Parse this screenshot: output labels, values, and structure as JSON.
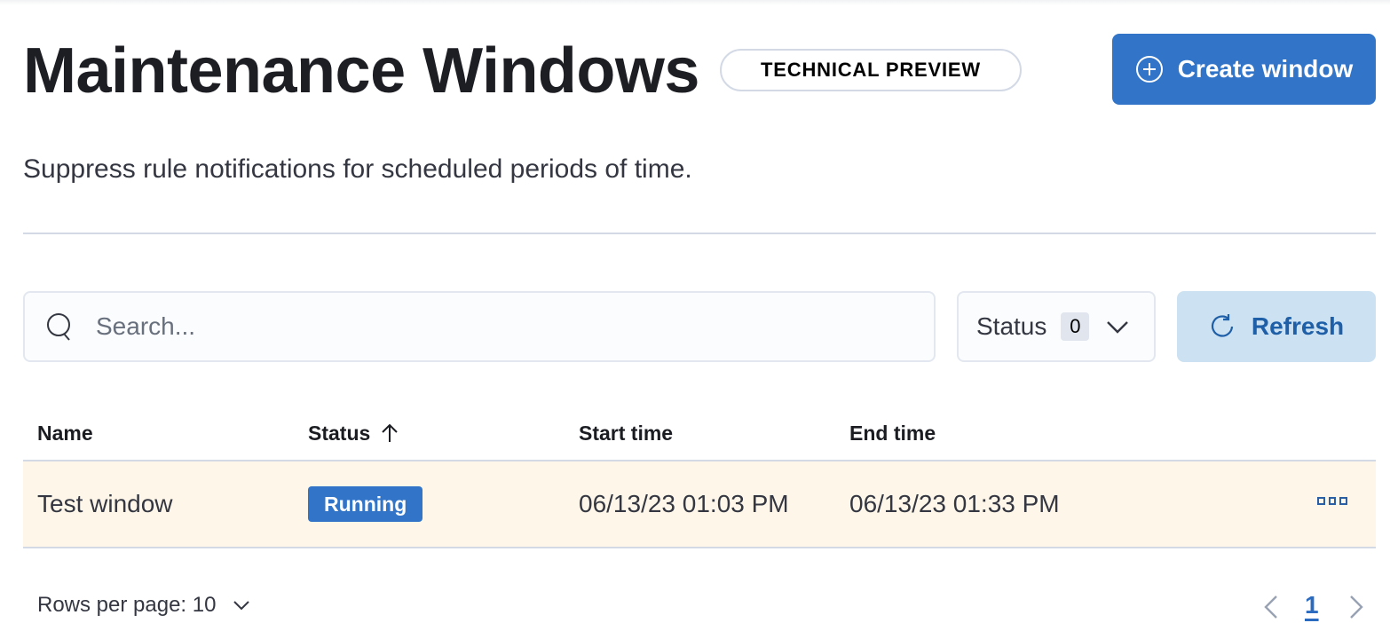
{
  "header": {
    "title": "Maintenance Windows",
    "badge": "TECHNICAL PREVIEW",
    "create_button": "Create window",
    "subtitle": "Suppress rule notifications for scheduled periods of time."
  },
  "toolbar": {
    "search_placeholder": "Search...",
    "search_value": "",
    "status_filter_label": "Status",
    "status_filter_count": "0",
    "refresh_label": "Refresh"
  },
  "table": {
    "columns": [
      {
        "label": "Name"
      },
      {
        "label": "Status",
        "sort": "ascending"
      },
      {
        "label": "Start time"
      },
      {
        "label": "End time"
      }
    ],
    "rows": [
      {
        "name": "Test window",
        "status": "Running",
        "start_time": "06/13/23 01:03 PM",
        "end_time": "06/13/23 01:33 PM"
      }
    ]
  },
  "pagination": {
    "rows_per_page_label": "Rows per page: 10",
    "current_page": "1"
  },
  "colors": {
    "primary": "#3275c8",
    "refresh_bg": "#cce1f1",
    "row_highlight": "#fef7e9",
    "border": "#d3dae6"
  }
}
